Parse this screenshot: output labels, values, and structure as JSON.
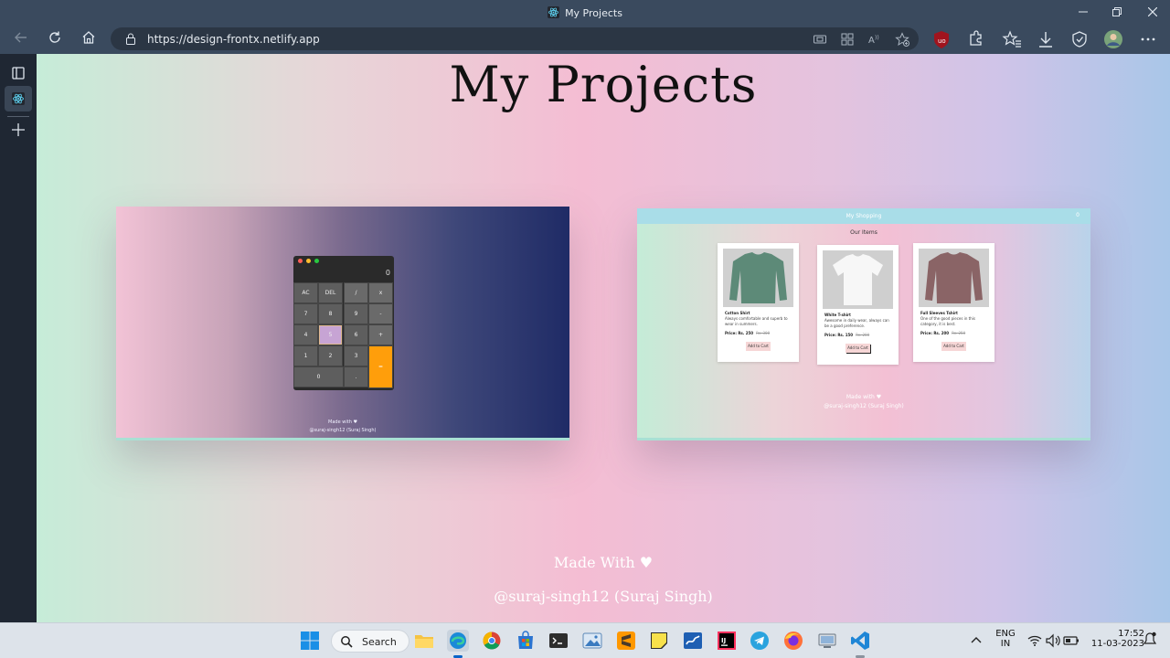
{
  "window": {
    "title": "My Projects"
  },
  "browser": {
    "url": "https://design-frontx.netlify.app"
  },
  "page": {
    "heading": "My Projects",
    "footer_made_with": "Made With ♥",
    "footer_credit": "@suraj-singh12 (Suraj Singh)"
  },
  "calculator_preview": {
    "display_value": "0",
    "keys": [
      "AC",
      "DEL",
      "/",
      "x",
      "7",
      "8",
      "9",
      "-",
      "4",
      "5",
      "6",
      "+",
      "1",
      "2",
      "3",
      "=",
      "0",
      "."
    ],
    "footer_made_with": "Made with ♥",
    "footer_credit": "@suraj-singh12 (Suraj Singh)"
  },
  "shopping_preview": {
    "nav_title": "My Shopping",
    "cart_label": "0",
    "section_title": "Our Items",
    "items": [
      {
        "name": "Cotton Shirt",
        "description": "Always comfortable and superb to wear in summers.",
        "price": "Price: Rs. 250",
        "old_price": "Rs. 300",
        "button": "Add to Cart"
      },
      {
        "name": "White T-shirt",
        "description": "Awesome in daily wear, always can be a good preference.",
        "price": "Price: Rs. 150",
        "old_price": "Rs. 200",
        "button": "Add to Cart"
      },
      {
        "name": "Full Sleeves Tshirt",
        "description": "One of the good pieces in this category, it is best.",
        "price": "Price: Rs. 200",
        "old_price": "Rs. 250",
        "button": "Add to Cart"
      }
    ],
    "footer_made_with": "Made with ♥",
    "footer_credit": "@suraj-singh12 (Suraj Singh)"
  },
  "taskbar": {
    "search_label": "Search",
    "language_line1": "ENG",
    "language_line2": "IN",
    "time": "17:52",
    "date": "11-03-2023"
  },
  "icons": {
    "back": "arrow-left-icon",
    "refresh": "refresh-icon",
    "home": "home-icon",
    "lock": "lock-icon",
    "more": "more-icon",
    "windows": "windows-logo-icon"
  },
  "colors": {
    "browser_chrome": "#3a4a5e",
    "calculator_equals": "#ff9e0b",
    "calculator_highlight": "#c7a4d4",
    "taskbar": "#dde3ea"
  }
}
